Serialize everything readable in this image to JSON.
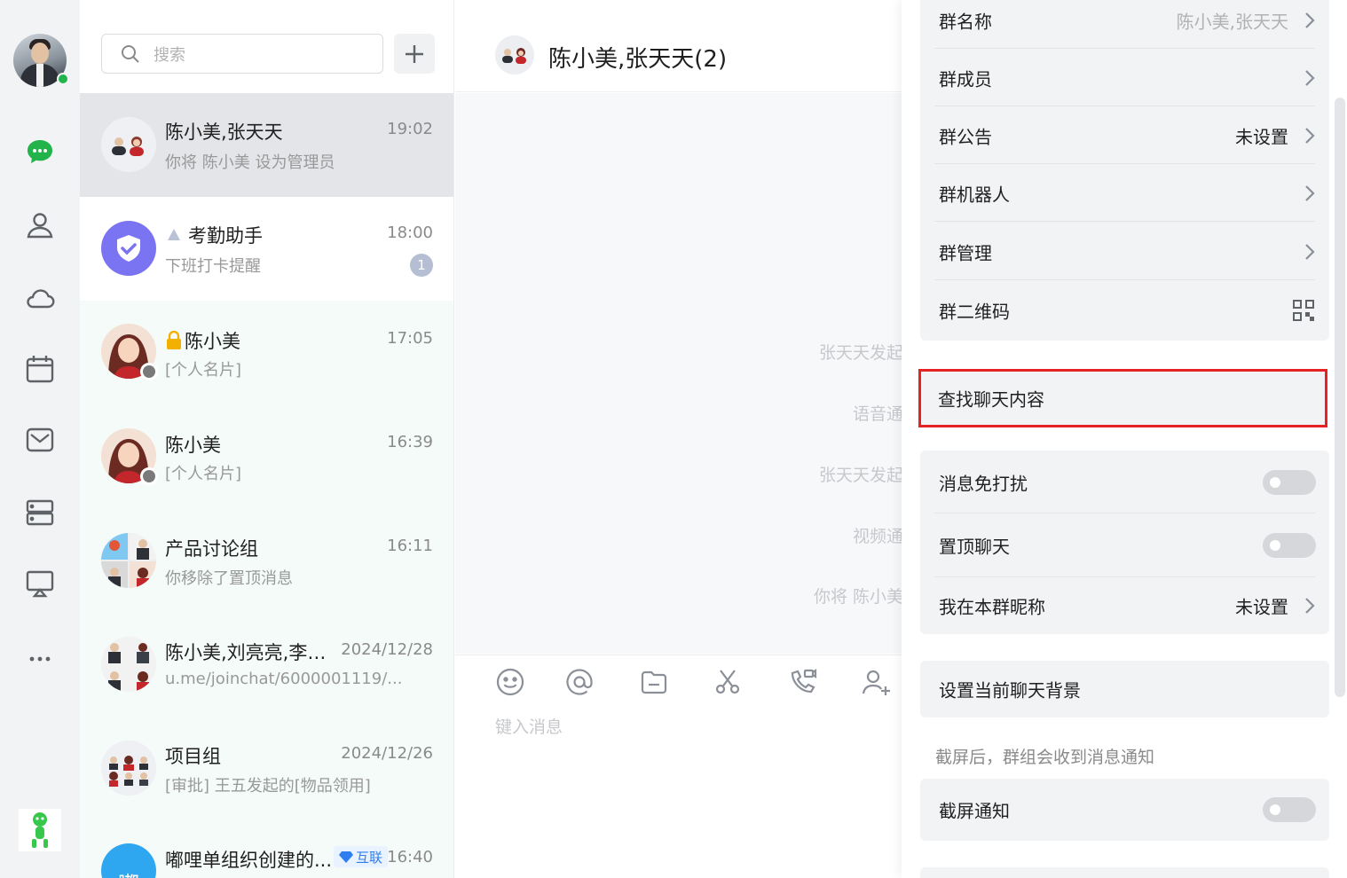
{
  "rail": {
    "items": [
      {
        "name": "chat-icon",
        "active": true
      },
      {
        "name": "contacts-icon"
      },
      {
        "name": "cloud-icon"
      },
      {
        "name": "calendar-icon"
      },
      {
        "name": "mail-icon"
      },
      {
        "name": "workbench-icon"
      },
      {
        "name": "screen-share-icon"
      },
      {
        "name": "more-icon"
      }
    ],
    "accent": "#22b34a"
  },
  "list": {
    "search_placeholder": "搜索",
    "conversations": [
      {
        "title": "陈小美,张天天",
        "time": "19:02",
        "preview": "你将 陈小美 设为管理员"
      },
      {
        "title": "考勤助手",
        "time": "18:00",
        "preview": "下班打卡提醒",
        "badge": "1"
      },
      {
        "title": "陈小美",
        "time": "17:05",
        "preview": "[个人名片]"
      },
      {
        "title": "陈小美",
        "time": "16:39",
        "preview": "[个人名片]"
      },
      {
        "title": "产品讨论组",
        "time": "16:11",
        "preview": "你移除了置顶消息"
      },
      {
        "title": "陈小美,刘亮亮,李丽...",
        "time": "2024/12/28",
        "preview": "u.me/joinchat/6000001119/..."
      },
      {
        "title": "项目组",
        "time": "2024/12/26",
        "preview": "[审批] 王五发起的[物品领用]"
      },
      {
        "title": "嘟哩单组织创建的...",
        "time": "16:40",
        "tag": "互联",
        "avatar_char": "嘟"
      }
    ]
  },
  "chat": {
    "title": "陈小美,张天天(2)",
    "system_messages": [
      "张天天发起",
      "语音通",
      "张天天发起",
      "视频通",
      "你将 陈小美"
    ],
    "compose_placeholder": "键入消息",
    "toolbar": [
      "emoji-icon",
      "mention-icon",
      "folder-icon",
      "screenshot-icon",
      "call-icon",
      "add-member-icon"
    ]
  },
  "panel": {
    "group_name_label": "群名称",
    "group_name_value": "陈小美,张天天",
    "members_label": "群成员",
    "notice_label": "群公告",
    "notice_value": "未设置",
    "robot_label": "群机器人",
    "manage_label": "群管理",
    "qrcode_label": "群二维码",
    "search_history_label": "查找聊天内容",
    "mute_label": "消息免打扰",
    "pin_label": "置顶聊天",
    "nickname_label": "我在本群昵称",
    "nickname_value": "未设置",
    "background_label": "设置当前聊天背景",
    "screenshot_hint": "截屏后，群组会收到消息通知",
    "screenshot_notify_label": "截屏通知",
    "highlight_color": "#e62222"
  }
}
